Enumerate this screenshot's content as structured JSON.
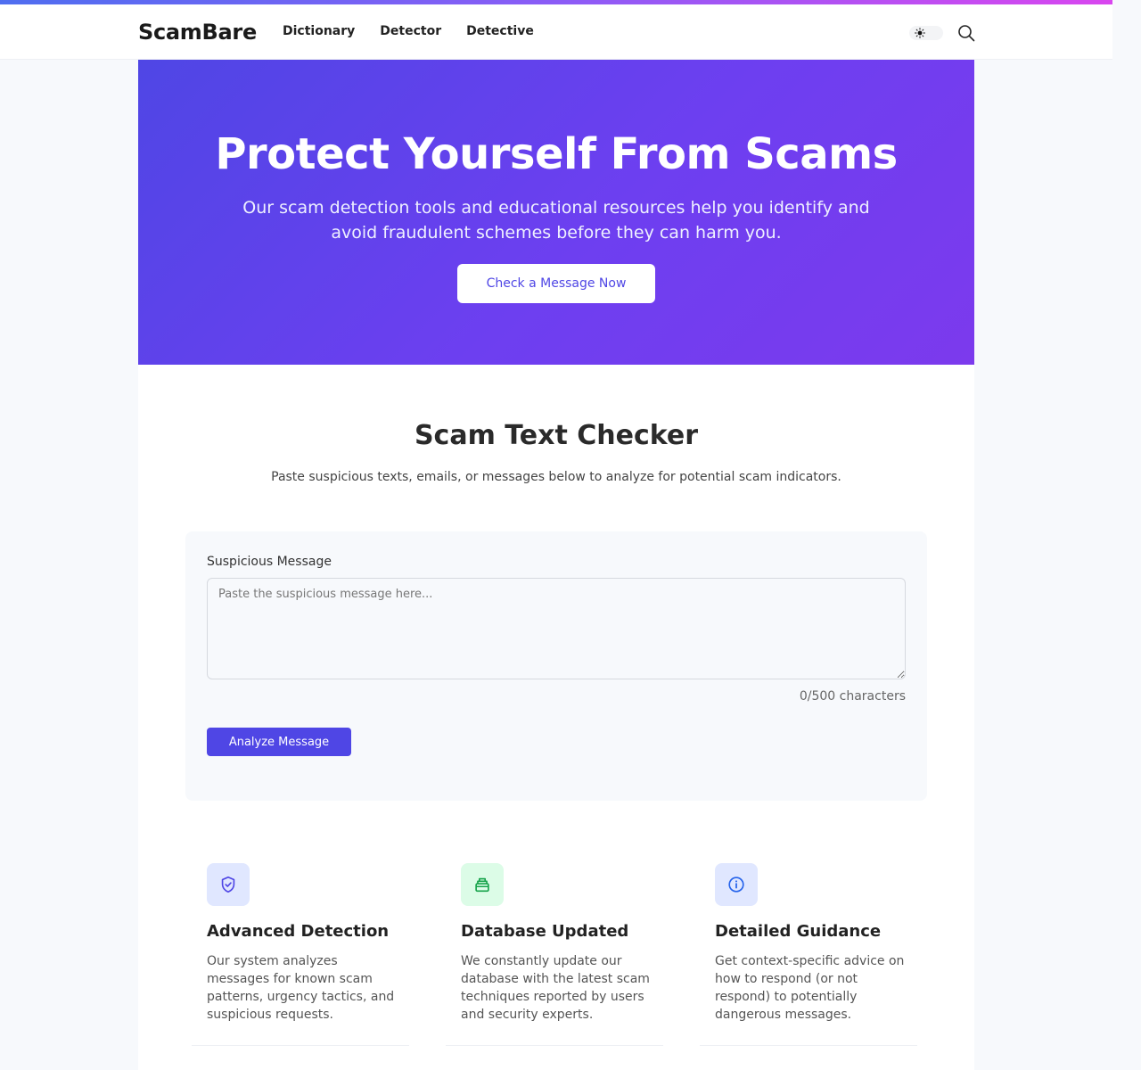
{
  "header": {
    "logo": "ScamBare",
    "nav": [
      "Dictionary",
      "Detector",
      "Detective"
    ]
  },
  "hero": {
    "title": "Protect Yourself From Scams",
    "subtitle": "Our scam detection tools and educational resources help you identify and avoid fraudulent schemes before they can harm you.",
    "cta": "Check a Message Now"
  },
  "checker": {
    "title": "Scam Text Checker",
    "subtitle": "Paste suspicious texts, emails, or messages below to analyze for potential scam indicators.",
    "field_label": "Suspicious Message",
    "placeholder": "Paste the suspicious message here...",
    "value": "",
    "char_count": "0/500 characters",
    "analyze_label": "Analyze Message"
  },
  "features": [
    {
      "title": "Advanced Detection",
      "text": "Our system analyzes messages for known scam patterns, urgency tactics, and suspicious requests.",
      "icon": "shield-check-icon"
    },
    {
      "title": "Database Updated",
      "text": "We constantly update our database with the latest scam techniques reported by users and security experts.",
      "icon": "database-icon"
    },
    {
      "title": "Detailed Guidance",
      "text": "Get context-specific advice on how to respond (or not respond) to potentially dangerous messages.",
      "icon": "info-icon"
    }
  ],
  "colors": {
    "accent": "#4f46e5",
    "hero_gradient_start": "#4f46e5",
    "hero_gradient_end": "#7c3aed",
    "feature_blue_bg": "#e0e7ff",
    "feature_green_bg": "#dcfce7"
  }
}
